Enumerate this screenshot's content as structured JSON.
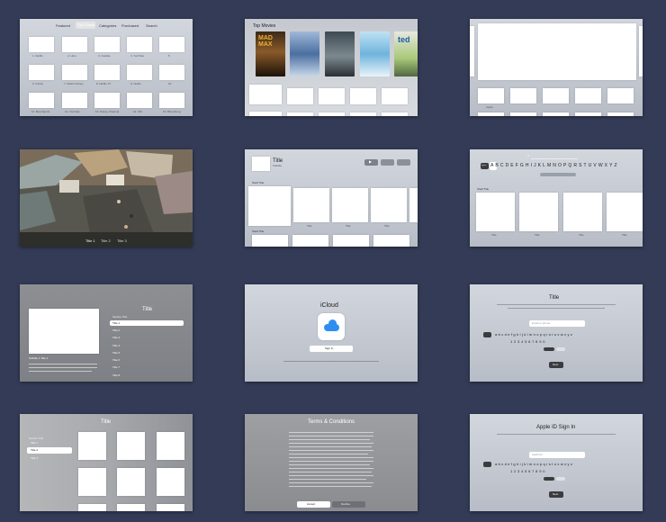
{
  "thumb1": {
    "tabs": [
      "Featured",
      "Top Charts",
      "Categories",
      "Purchased",
      "Search"
    ],
    "cards": [
      "1. Netflix",
      "2. Hulu",
      "3. Crackle",
      "4. YouTube",
      "5.",
      "6. Infinity",
      "7. Watch Disney",
      "8. Netflix TV",
      "9. Netflix",
      "10.",
      "11. Best Sports",
      "12. YouTube",
      "13. Disney Channel",
      "14. SIS",
      "15. Bloomberg"
    ]
  },
  "thumb2": {
    "section_title": "Top Movies"
  },
  "thumb3": {
    "caption": "Apple"
  },
  "thumb4": {
    "tabs": [
      "Title 1",
      "Title 2",
      "Title 3"
    ]
  },
  "thumb5": {
    "title": "Title",
    "subtitle": "Subtitle",
    "shelf1": "Shelf Title",
    "shelf2": "Shelf Title",
    "item_label": "Title"
  },
  "thumb6": {
    "keyboard": "ABCDEFGHIJKLMNOPQRSTUVWXYZ",
    "space_key": "space",
    "shelf": "Shelf Title",
    "item_label": "Title"
  },
  "thumb7": {
    "title": "Title",
    "section": "Section Title",
    "menu": [
      "Title 1",
      "Title 2",
      "Title 3",
      "Title 4",
      "Title 5",
      "Title 6",
      "Title 7",
      "Title 8"
    ],
    "detail_title": "Subtitle 1 Title 1"
  },
  "thumb8": {
    "title": "iCloud",
    "button": "Sign In"
  },
  "thumb9": {
    "title": "Title",
    "placeholder": "Email or phone",
    "letters": "abcdefghijklmnopqrstuvwxyz",
    "digits": "1234567890",
    "button": "Next"
  },
  "thumb10": {
    "title": "Title",
    "section": "Section Title",
    "menu": [
      "Title 1",
      "Title 2",
      "Title 3"
    ]
  },
  "thumb11": {
    "title": "Terms & Conditions",
    "accept": "Accept",
    "decline": "Decline"
  },
  "thumb12": {
    "title": "Apple ID Sign In",
    "placeholder": "Apple ID",
    "letters": "abcdefghijklmnopqrstuvwxyz",
    "digits": "1234567890",
    "button": "Next"
  }
}
